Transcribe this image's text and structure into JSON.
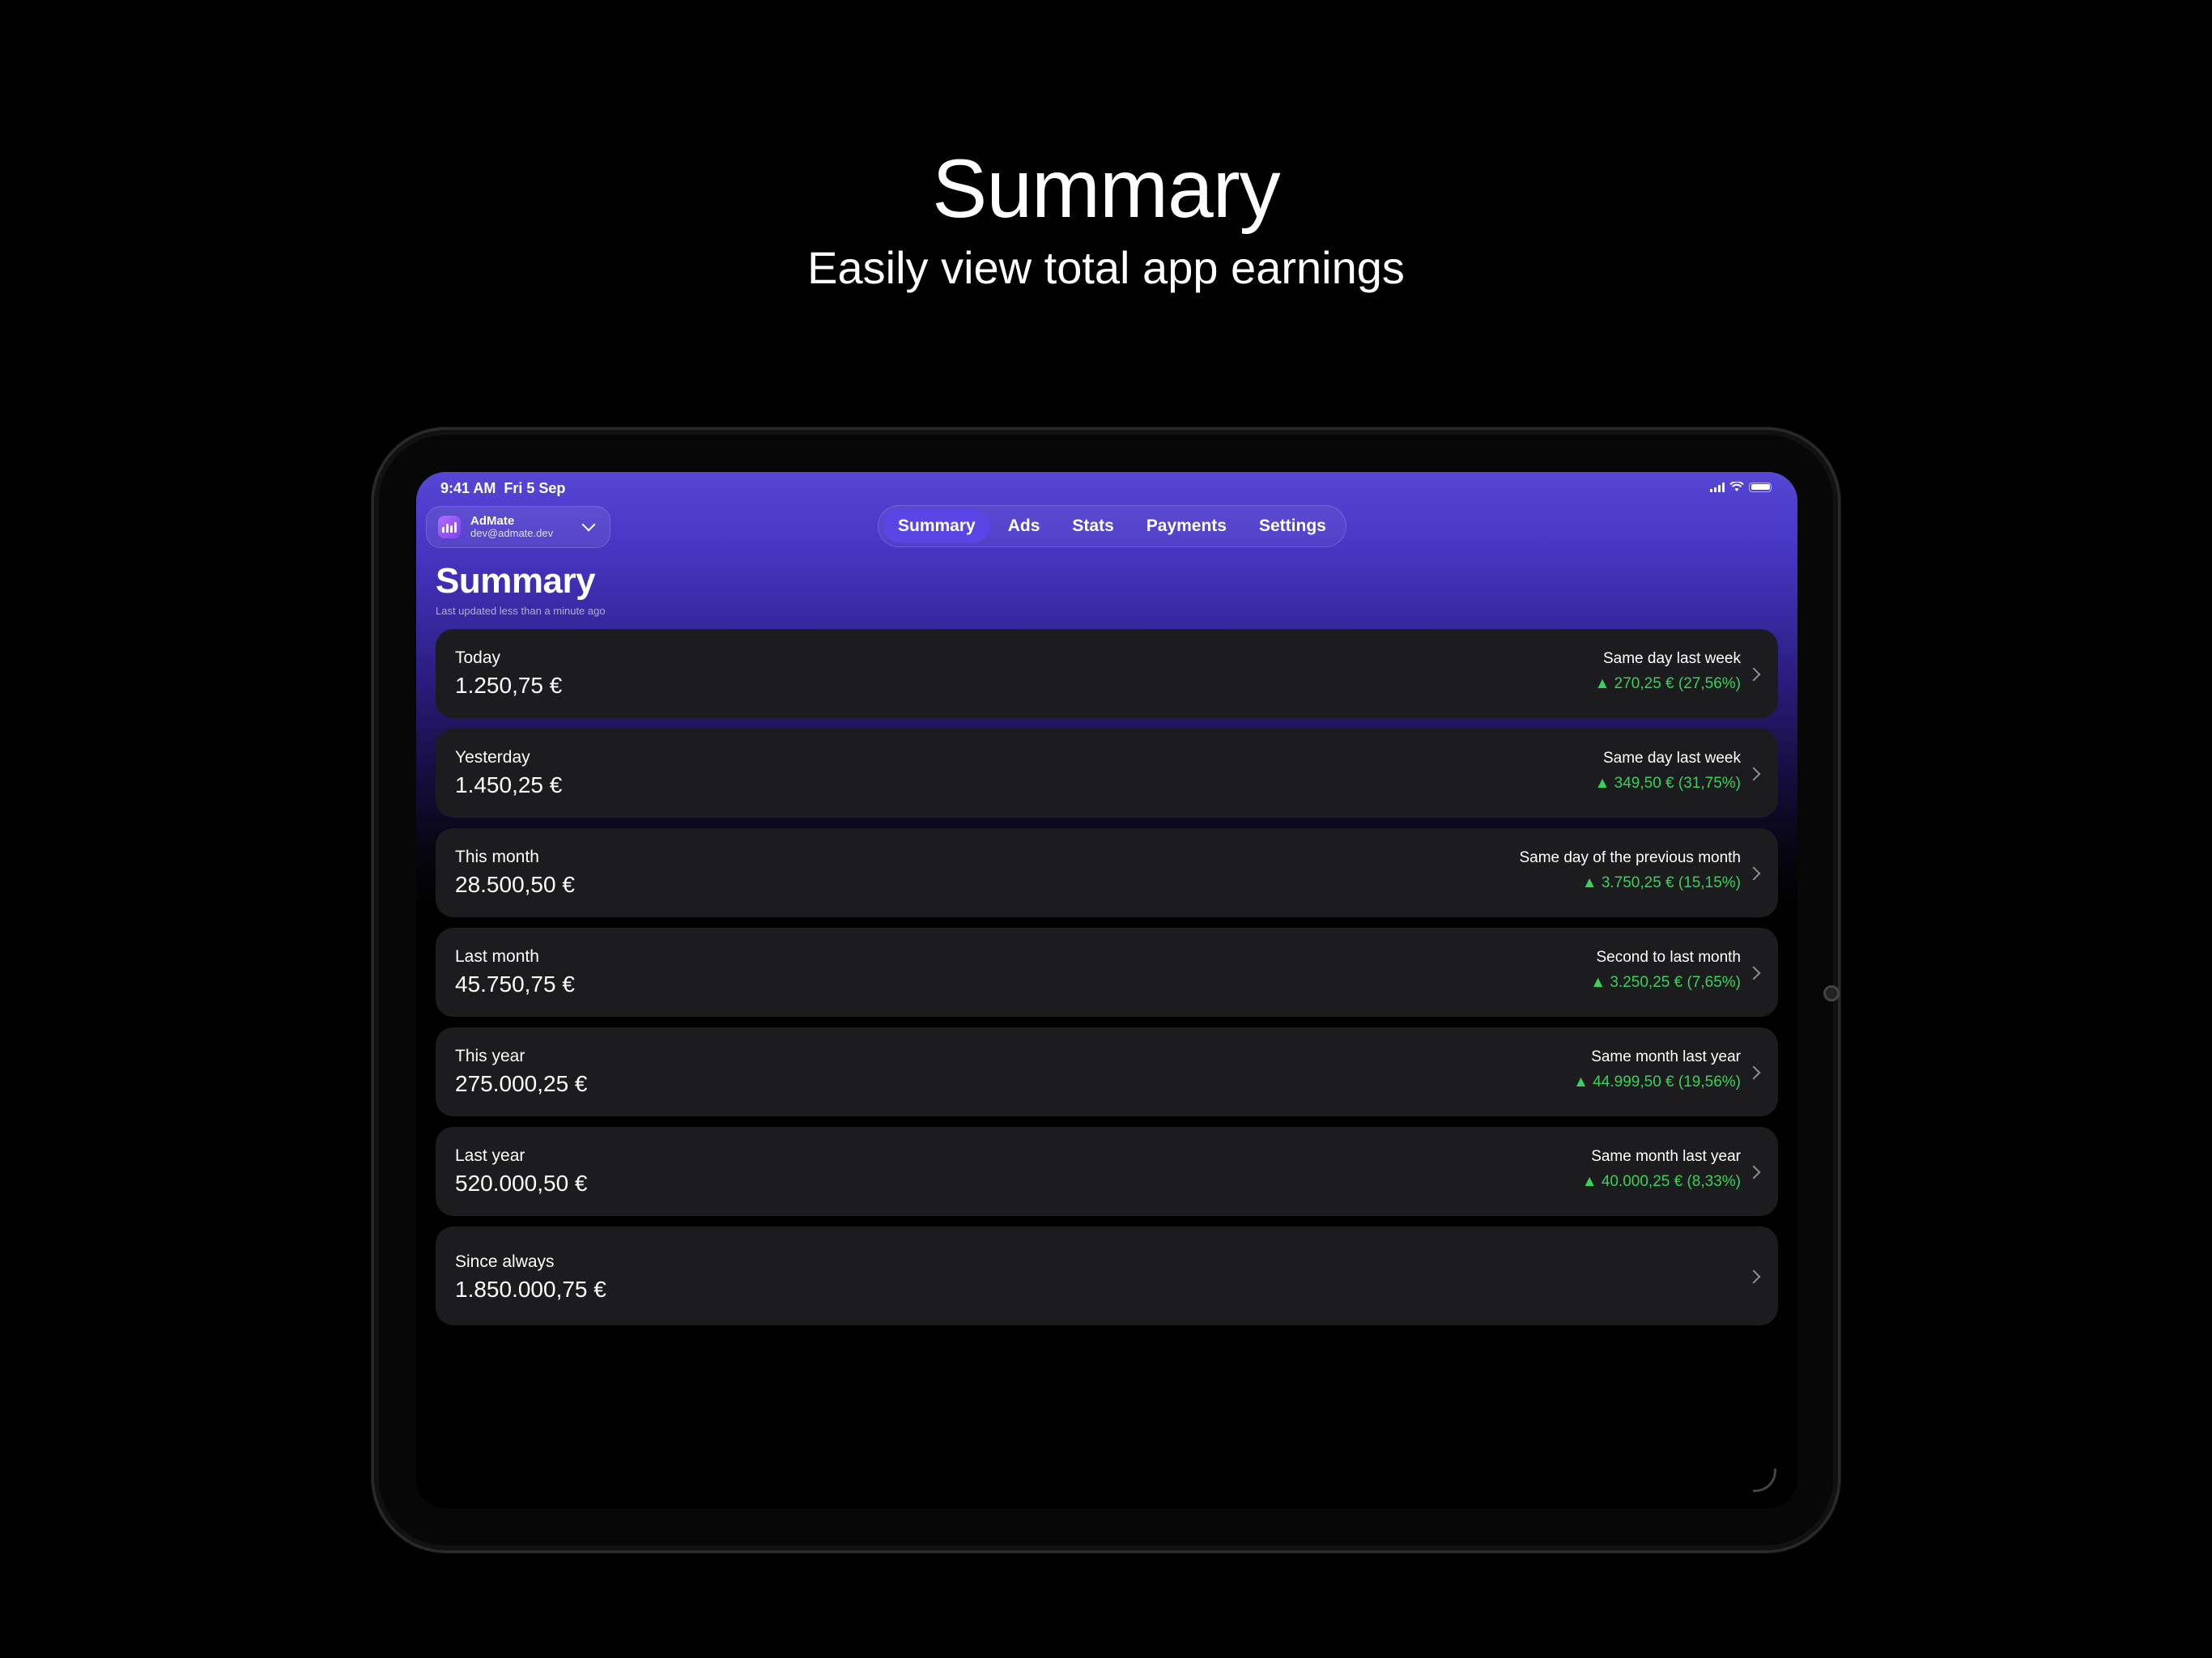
{
  "hero": {
    "title": "Summary",
    "subtitle": "Easily view total app earnings"
  },
  "status_bar": {
    "time": "9:41 AM",
    "date": "Fri 5 Sep",
    "icons": [
      "cellular-signal-icon",
      "wifi-icon",
      "battery-icon"
    ]
  },
  "account": {
    "app_name": "AdMate",
    "email": "dev@admate.dev",
    "icon": "chart-bars-icon"
  },
  "tabs": [
    {
      "label": "Summary",
      "active": true
    },
    {
      "label": "Ads",
      "active": false
    },
    {
      "label": "Stats",
      "active": false
    },
    {
      "label": "Payments",
      "active": false
    },
    {
      "label": "Settings",
      "active": false
    }
  ],
  "page": {
    "title": "Summary",
    "subtitle": "Last updated less than a minute ago"
  },
  "cards": [
    {
      "label": "Today",
      "value": "1.250,75 €",
      "comparison_label": "Same day last week",
      "comparison_value": "▲ 270,25 € (27,56%)"
    },
    {
      "label": "Yesterday",
      "value": "1.450,25 €",
      "comparison_label": "Same day last week",
      "comparison_value": "▲ 349,50 € (31,75%)"
    },
    {
      "label": "This month",
      "value": "28.500,50 €",
      "comparison_label": "Same day of the previous month",
      "comparison_value": "▲ 3.750,25 € (15,15%)"
    },
    {
      "label": "Last month",
      "value": "45.750,75 €",
      "comparison_label": "Second to last month",
      "comparison_value": "▲ 3.250,25 € (7,65%)"
    },
    {
      "label": "This year",
      "value": "275.000,25 €",
      "comparison_label": "Same month last year",
      "comparison_value": "▲ 44.999,50 € (19,56%)"
    },
    {
      "label": "Last year",
      "value": "520.000,50 €",
      "comparison_label": "Same month last year",
      "comparison_value": "▲ 40.000,25 € (8,33%)"
    },
    {
      "label": "Since always",
      "value": "1.850.000,75 €"
    }
  ],
  "colors": {
    "accent": "#5a45e6",
    "positive": "#37d15b",
    "card_bg": "#1c1c1e"
  }
}
